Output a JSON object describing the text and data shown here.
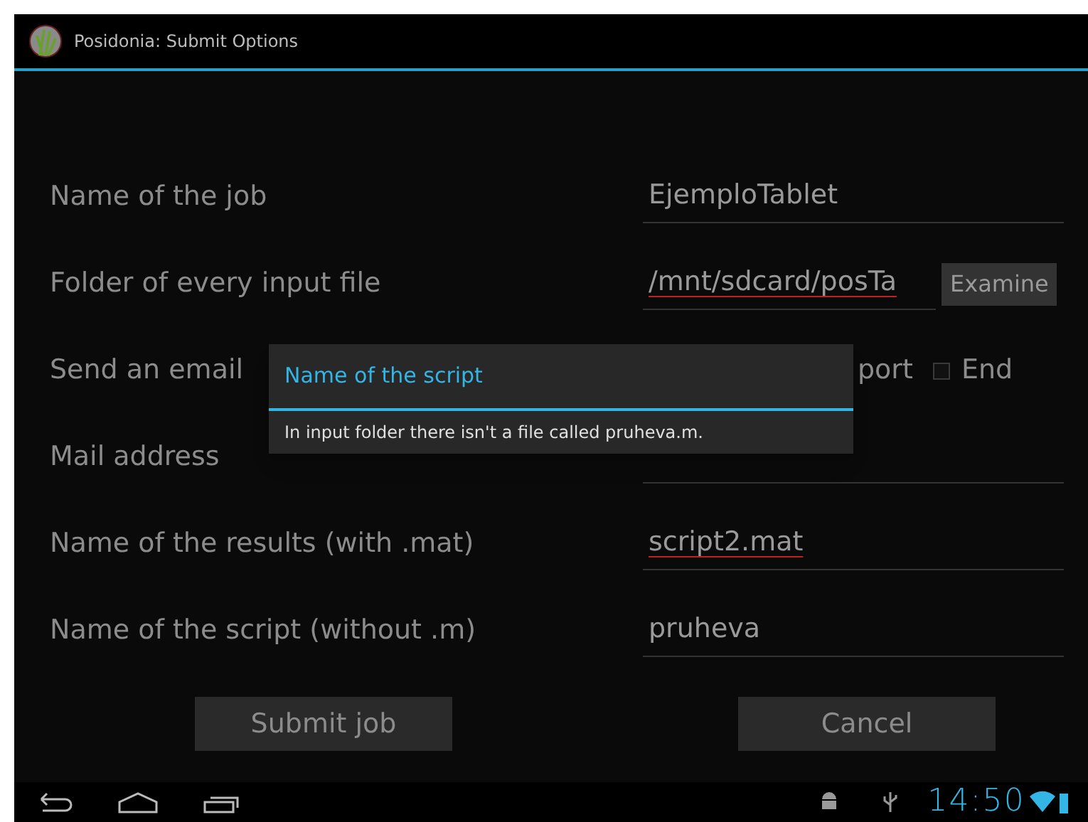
{
  "window": {
    "title": "Posidonia: Submit Options"
  },
  "rows": [
    {
      "kind": "field",
      "label": "Name of the job",
      "value": "EjemploTablet",
      "misspelled": false
    },
    {
      "kind": "folder",
      "label": "Folder of every input file",
      "value": "/mnt/sdcard/posTa",
      "misspelled": true,
      "button": "Examine"
    },
    {
      "kind": "checks",
      "label": "Send an email",
      "partial_text": "port",
      "checks": [
        {
          "label": "End",
          "checked": false
        }
      ]
    },
    {
      "kind": "field",
      "label": "Mail address"
    },
    {
      "kind": "field",
      "label": "Name of the results (with .mat)",
      "value": "script2.mat",
      "misspelled": true
    },
    {
      "kind": "field",
      "label": "Name of the script (without .m)",
      "value": "pruheva",
      "misspelled": false
    }
  ],
  "buttons": [
    "Submit job",
    "Cancel"
  ],
  "dialog": {
    "title": "Name of the script",
    "message": "In input folder there isn't a file called pruheva.m."
  },
  "status_bar": {
    "time": "14:50"
  }
}
